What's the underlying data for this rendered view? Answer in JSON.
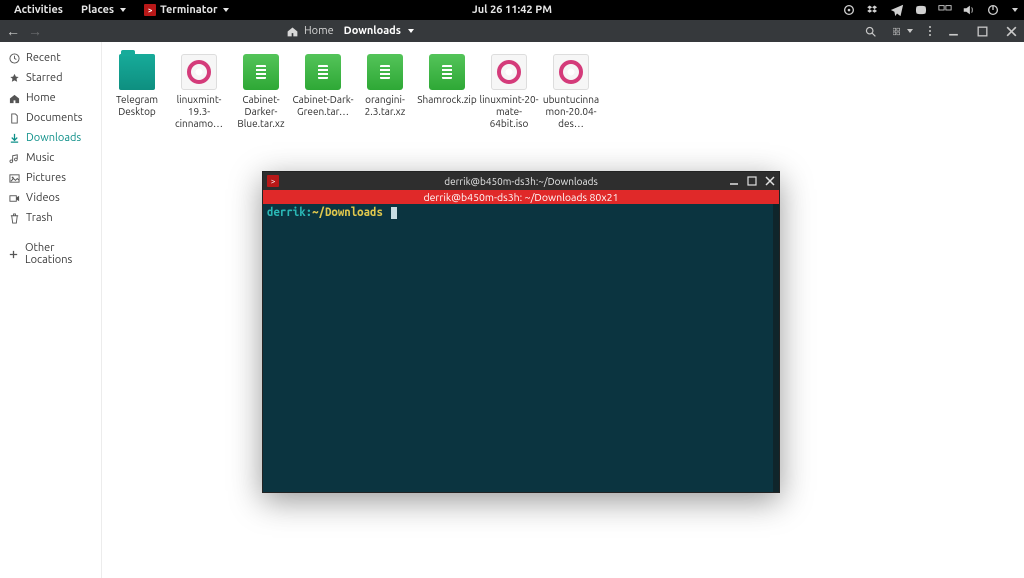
{
  "topbar": {
    "activities": "Activities",
    "places": "Places",
    "app": "Terminator",
    "clock": "Jul 26  11:42 PM"
  },
  "fm": {
    "path_home": "Home",
    "path_current": "Downloads"
  },
  "sidebar": {
    "recent": "Recent",
    "starred": "Starred",
    "home": "Home",
    "documents": "Documents",
    "downloads": "Downloads",
    "music": "Music",
    "pictures": "Pictures",
    "videos": "Videos",
    "trash": "Trash",
    "other": "Other Locations"
  },
  "files": {
    "f0": "Telegram Desktop",
    "f1": "linuxmint-19.3-cinnamo…",
    "f2": "Cabinet-Darker-Blue.tar.xz",
    "f3": "Cabinet-Dark-Green.tar…",
    "f4": "orangini-2.3.tar.xz",
    "f5": "Shamrock.zip",
    "f6": "linuxmint-20-mate-64bit.iso",
    "f7": "ubuntucinnamon-20.04-des…"
  },
  "terminal": {
    "window_title": "derrik@b450m-ds3h:~/Downloads",
    "tab_label": "derrik@b450m-ds3h: ~/Downloads 80x21",
    "prompt_user": "derrik:",
    "prompt_path": "~/Downloads"
  }
}
